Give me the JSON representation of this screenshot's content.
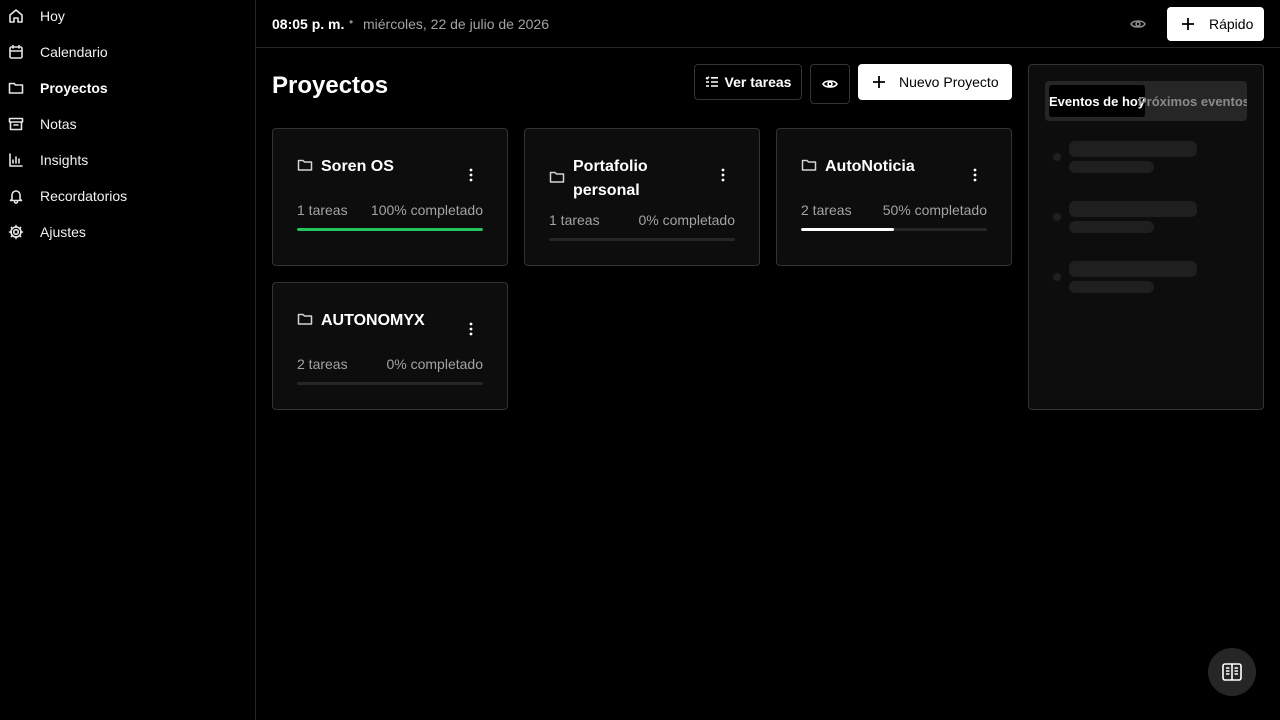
{
  "sidebar": {
    "items": [
      {
        "label": "Hoy",
        "icon": "home-icon"
      },
      {
        "label": "Calendario",
        "icon": "calendar-icon"
      },
      {
        "label": "Proyectos",
        "icon": "folder-icon",
        "active": true
      },
      {
        "label": "Notas",
        "icon": "archive-icon"
      },
      {
        "label": "Insights",
        "icon": "bar-chart-icon"
      },
      {
        "label": "Recordatorios",
        "icon": "bell-icon"
      },
      {
        "label": "Ajustes",
        "icon": "gear-icon"
      }
    ]
  },
  "header": {
    "time": "08:05 p. m.",
    "separator": "•",
    "date": "miércoles, 22 de julio de 2026",
    "quick_label": "Rápido"
  },
  "main": {
    "title": "Proyectos",
    "view_tasks_label": "Ver tareas",
    "new_project_label": "Nuevo Proyecto",
    "projects": [
      {
        "name": "Soren OS",
        "tasks": "1 tareas",
        "progress_label": "100% completado",
        "progress": 1.0,
        "color": "#22c55e"
      },
      {
        "name": "Portafolio personal",
        "tasks": "1 tareas",
        "progress_label": "0% completado",
        "progress": 0.0,
        "color": "#ffffff"
      },
      {
        "name": "AutoNoticia",
        "tasks": "2 tareas",
        "progress_label": "50% completado",
        "progress": 0.5,
        "color": "#ffffff"
      },
      {
        "name": "AUTONOMYX",
        "tasks": "2 tareas",
        "progress_label": "0% completado",
        "progress": 0.0,
        "color": "#ffffff"
      }
    ]
  },
  "events": {
    "tab_today": "Eventos de hoy",
    "tab_upcoming": "Próximos eventos"
  },
  "colors": {
    "background": "#000000",
    "accent_success": "#22c55e",
    "card": "#0d0d0d",
    "border": "#333333"
  }
}
